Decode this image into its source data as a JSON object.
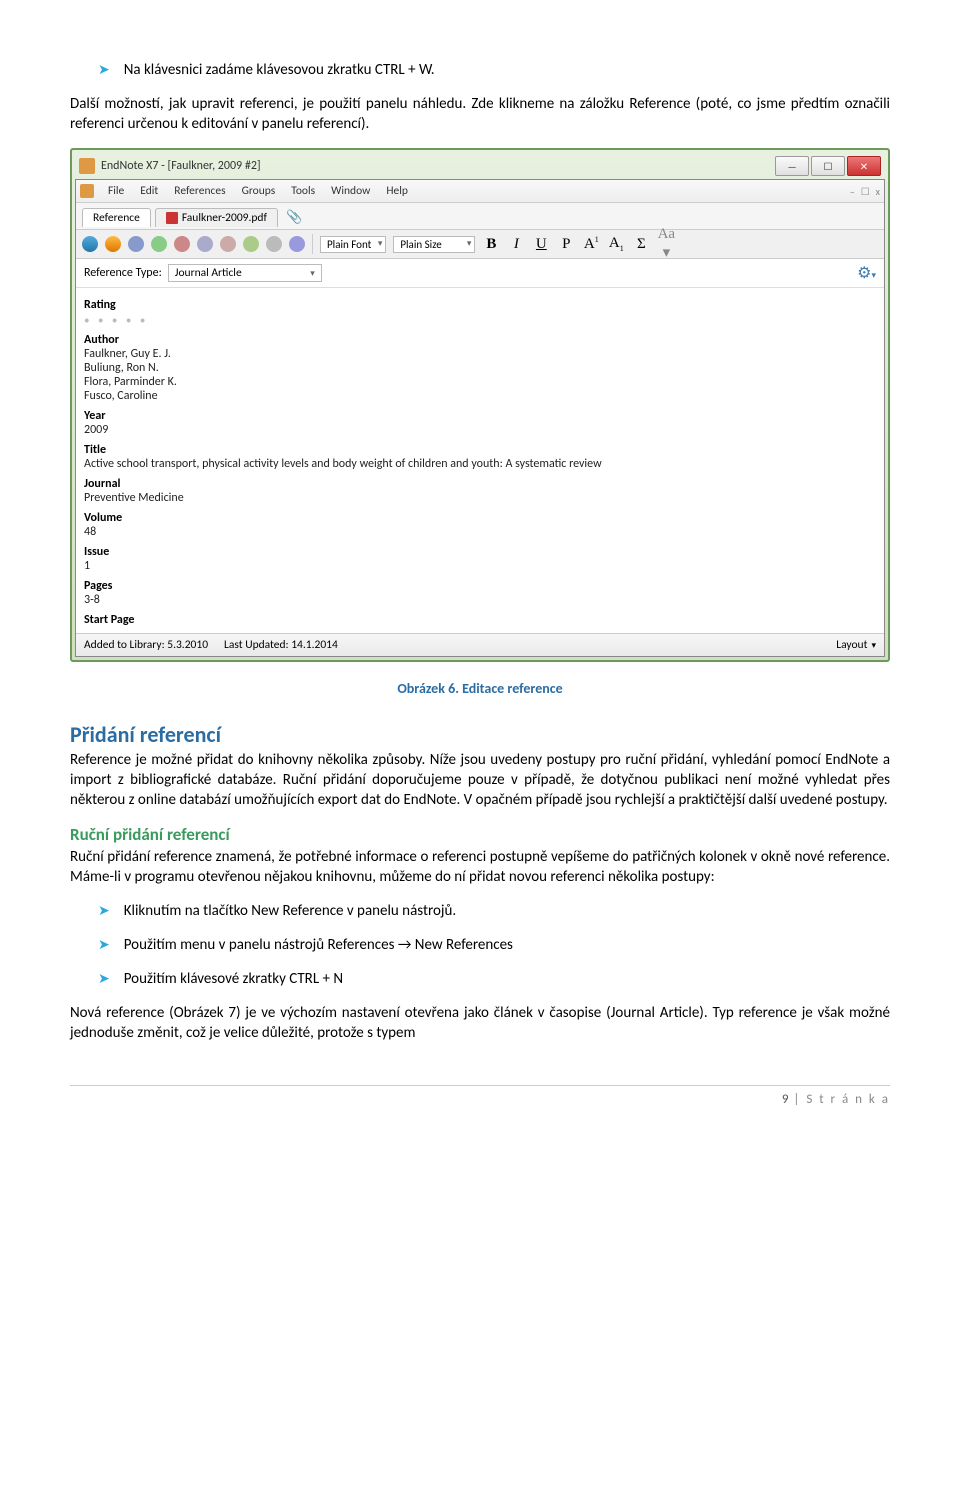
{
  "intro": {
    "bullet1": "Na klávesnici zadáme klávesovou zkratku CTRL + W.",
    "para1": "Další možností, jak upravit referenci, je použití panelu náhledu. Zde klikneme na záložku Reference (poté, co jsme předtím označili referenci určenou k editování v panelu referencí)."
  },
  "app": {
    "title": "EndNote X7 - [Faulkner, 2009 #2]",
    "menu": [
      "File",
      "Edit",
      "References",
      "Groups",
      "Tools",
      "Window",
      "Help"
    ],
    "tabs": {
      "ref": "Reference",
      "pdf": "Faulkner-2009.pdf"
    },
    "toolbar": {
      "plain_font": "Plain Font",
      "plain_size": "Plain Size"
    },
    "reftype": {
      "label": "Reference Type:",
      "value": "Journal Article"
    },
    "fields": {
      "rating_label": "Rating",
      "author_label": "Author",
      "authors": [
        "Faulkner, Guy E. J.",
        "Buliung, Ron N.",
        "Flora, Parminder K.",
        "Fusco, Caroline"
      ],
      "year_label": "Year",
      "year_val": "2009",
      "title_label": "Title",
      "title_val": "Active school transport, physical activity levels and body weight of children and youth: A systematic review",
      "journal_label": "Journal",
      "journal_val": "Preventive Medicine",
      "volume_label": "Volume",
      "volume_val": "48",
      "issue_label": "Issue",
      "issue_val": "1",
      "pages_label": "Pages",
      "pages_val": "3-8",
      "start_label": "Start Page"
    },
    "status": {
      "added": "Added to Library: 5.3.2010",
      "updated": "Last Updated: 14.1.2014",
      "layout": "Layout"
    }
  },
  "caption": "Obrázek 6. Editace reference",
  "sec1": {
    "heading": "Přidání referencí",
    "para": "Reference je možné přidat do knihovny několika způsoby. Níže jsou uvedeny postupy pro ruční přidání, vyhledání pomocí EndNote a import z bibliografické databáze. Ruční přidání doporučujeme pouze v případě, že dotyčnou publikaci není možné vyhledat přes některou z online databází umožňujících export dat do EndNote. V opačném případě jsou rychlejší a praktičtější další uvedené postupy."
  },
  "sec2": {
    "heading": "Ruční přidání referencí",
    "para": "Ruční přidání reference znamená, že potřebné informace o referenci postupně vepíšeme do patřičných kolonek v okně nové reference. Máme-li v programu otevřenou nějakou knihovnu, můžeme do ní přidat novou referenci několika postupy:",
    "bullets": [
      "Kliknutím na tlačítko New Reference v panelu nástrojů.",
      "Použitím menu v panelu nástrojů References → New References",
      "Použitím klávesové zkratky CTRL + N"
    ],
    "para2": "Nová reference (Obrázek 7) je ve výchozím nastavení otevřena jako článek v časopise (Journal Article). Typ reference je však možné jednoduše změnit, což je velice důležité, protože s typem"
  },
  "footer": {
    "page_num": "9",
    "page_word": "S t r á n k a"
  }
}
